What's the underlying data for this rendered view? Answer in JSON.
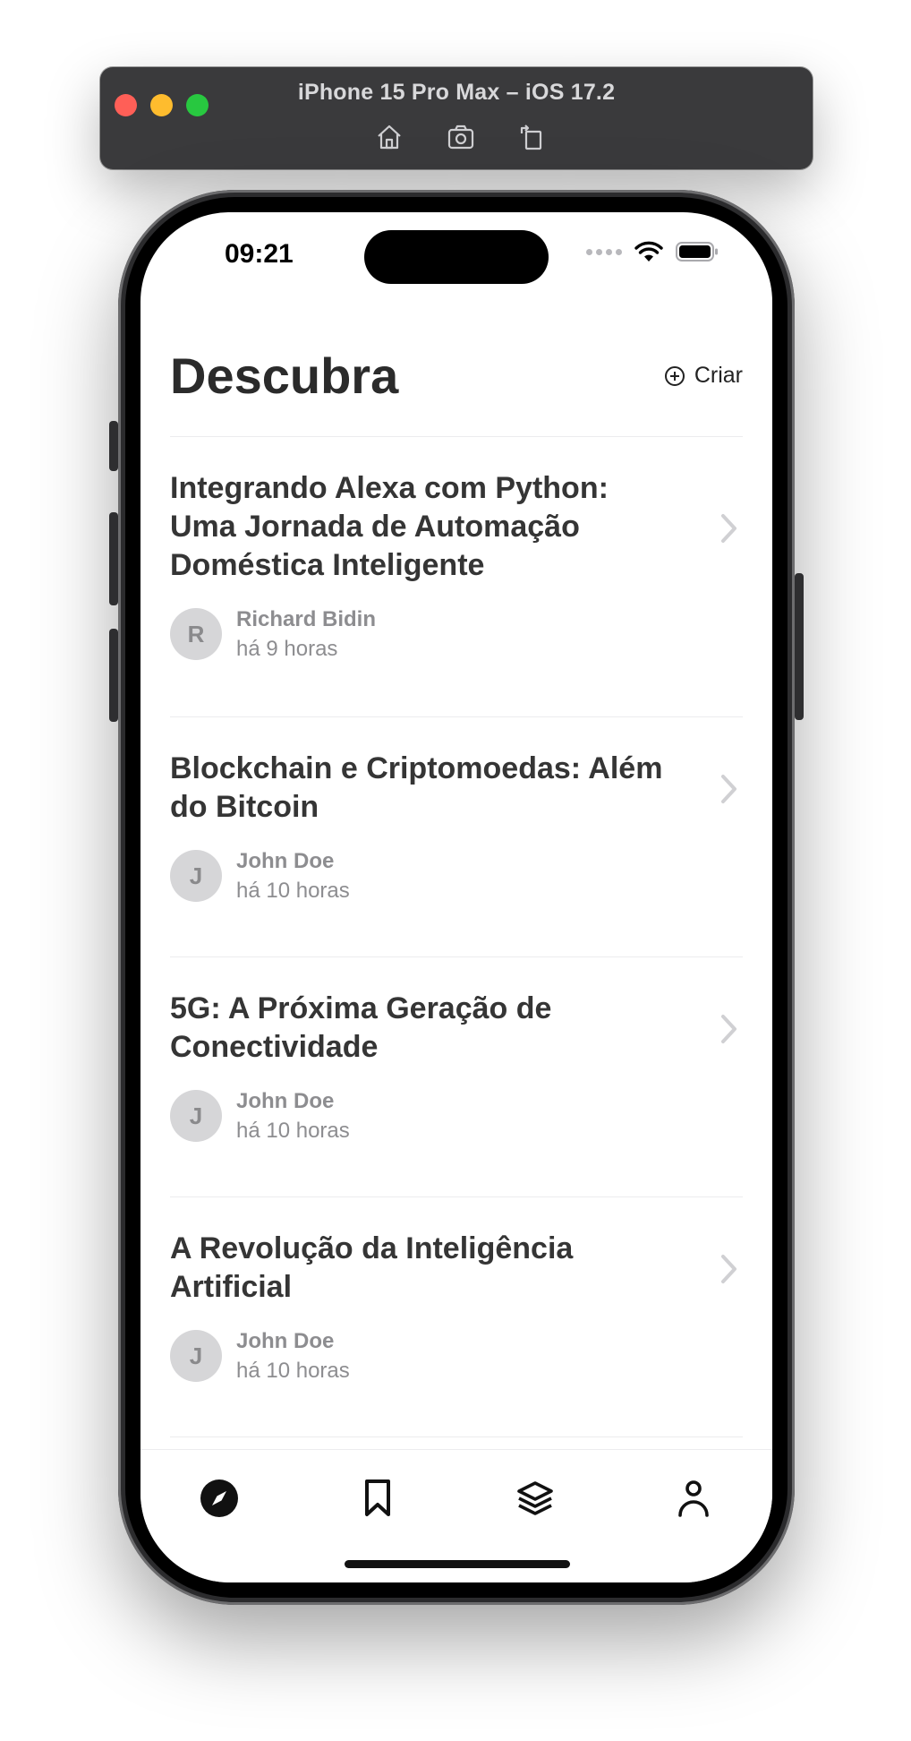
{
  "simulator": {
    "title": "iPhone 15 Pro Max – iOS 17.2",
    "tools": [
      "home-icon",
      "screenshot-icon",
      "rotate-icon"
    ]
  },
  "status_bar": {
    "time": "09:21"
  },
  "header": {
    "title": "Descubra",
    "create_label": "Criar"
  },
  "feed": [
    {
      "title": "Integrando Alexa com Python: Uma Jornada de Automação Doméstica Inteligente",
      "author_initial": "R",
      "author": "Richard Bidin",
      "time": "há 9 horas"
    },
    {
      "title": "Blockchain e Criptomoedas: Além do Bitcoin",
      "author_initial": "J",
      "author": "John Doe",
      "time": "há 10 horas"
    },
    {
      "title": "5G: A Próxima Geração de Conectividade",
      "author_initial": "J",
      "author": "John Doe",
      "time": "há 10 horas"
    },
    {
      "title": "A Revolução da Inteligência Artificial",
      "author_initial": "J",
      "author": "John Doe",
      "time": "há 10 horas"
    }
  ],
  "tab_bar": {
    "tabs": [
      "compass-icon",
      "bookmark-icon",
      "layers-icon",
      "person-icon"
    ],
    "active": "compass-icon"
  },
  "colors": {
    "simulator_bar": "#3a3a3c",
    "title_text": "#2b2b2b",
    "meta_text": "#8d8d90",
    "avatar_bg": "#d6d6d8"
  }
}
